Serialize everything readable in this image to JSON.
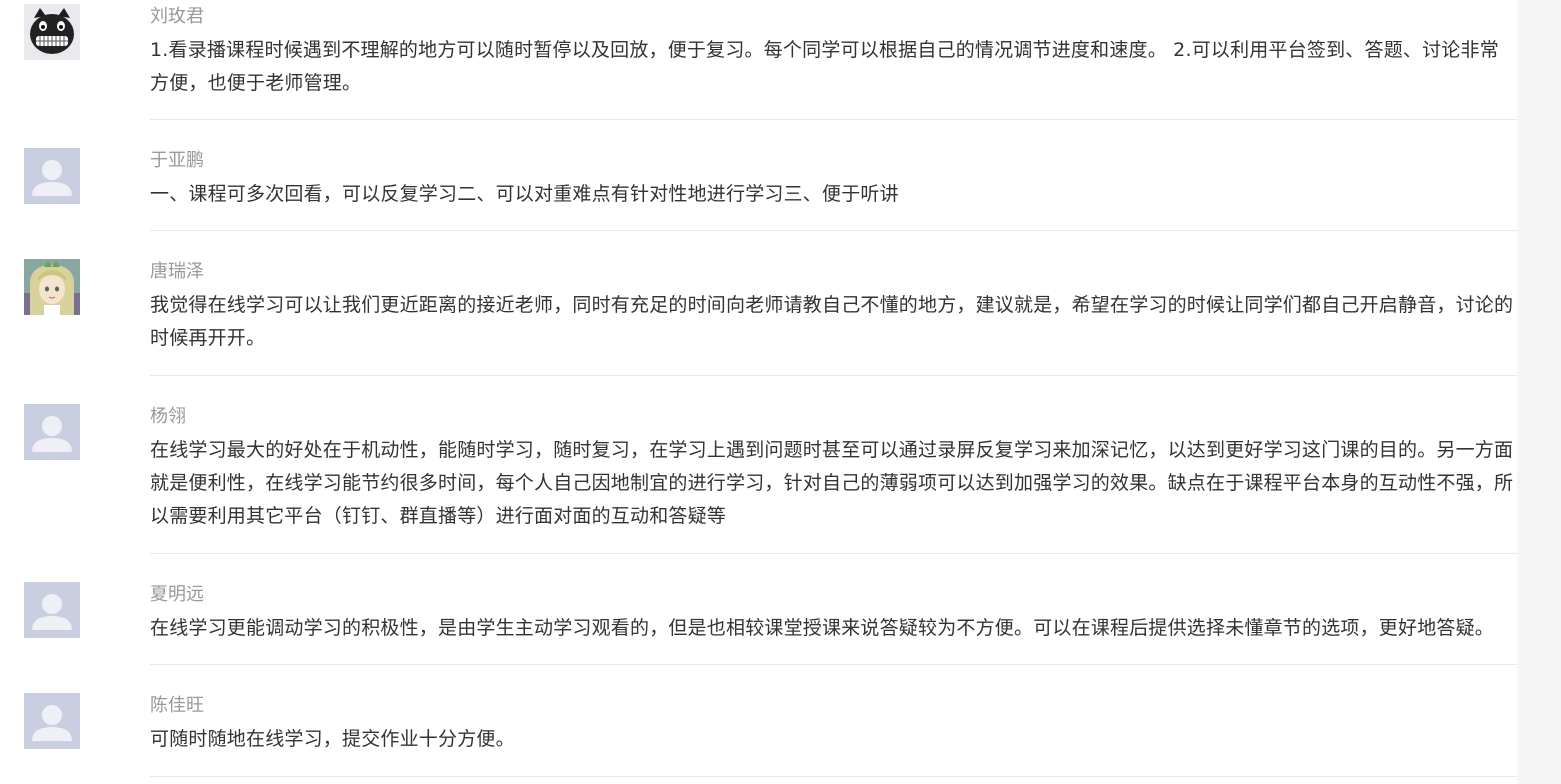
{
  "comments": [
    {
      "author": "刘玫君",
      "avatar": "black-cat-grin-avatar",
      "content": "1.看录播课程时候遇到不理解的地方可以随时暂停以及回放，便于复习。每个同学可以根据自己的情况调节进度和速度。 2.可以利用平台签到、答题、讨论非常方便，也便于老师管理。"
    },
    {
      "author": "于亚鹏",
      "avatar": "default-person-avatar",
      "content": "一、课程可多次回看，可以反复学习二、可以对重难点有针对性地进行学习三、便于听讲"
    },
    {
      "author": "唐瑞泽",
      "avatar": "anime-character-avatar",
      "content": "我觉得在线学习可以让我们更近距离的接近老师，同时有充足的时间向老师请教自己不懂的地方，建议就是，希望在学习的时候让同学们都自己开启静音，讨论的时候再开开。"
    },
    {
      "author": "杨翎",
      "avatar": "default-person-avatar",
      "content": "在线学习最大的好处在于机动性，能随时学习，随时复习，在学习上遇到问题时甚至可以通过录屏反复学习来加深记忆，以达到更好学习这门课的目的。另一方面就是便利性，在线学习能节约很多时间，每个人自己因地制宜的进行学习，针对自己的薄弱项可以达到加强学习的效果。缺点在于课程平台本身的互动性不强，所以需要利用其它平台（钉钉、群直播等）进行面对面的互动和答疑等"
    },
    {
      "author": "夏明远",
      "avatar": "default-person-avatar",
      "content": "在线学习更能调动学习的积极性，是由学生主动学习观看的，但是也相较课堂授课来说答疑较为不方便。可以在课程后提供选择未懂章节的选项，更好地答疑。"
    },
    {
      "author": "陈佳旺",
      "avatar": "default-person-avatar",
      "content": "可随时随地在线学习，提交作业十分方便。"
    }
  ],
  "colors": {
    "author": "#999999",
    "content": "#333333",
    "divider": "#e8e8e8",
    "default_avatar_bg": "#c9cfe0",
    "default_avatar_fg": "#eef0f6",
    "gutter": "#f5f5f5"
  }
}
